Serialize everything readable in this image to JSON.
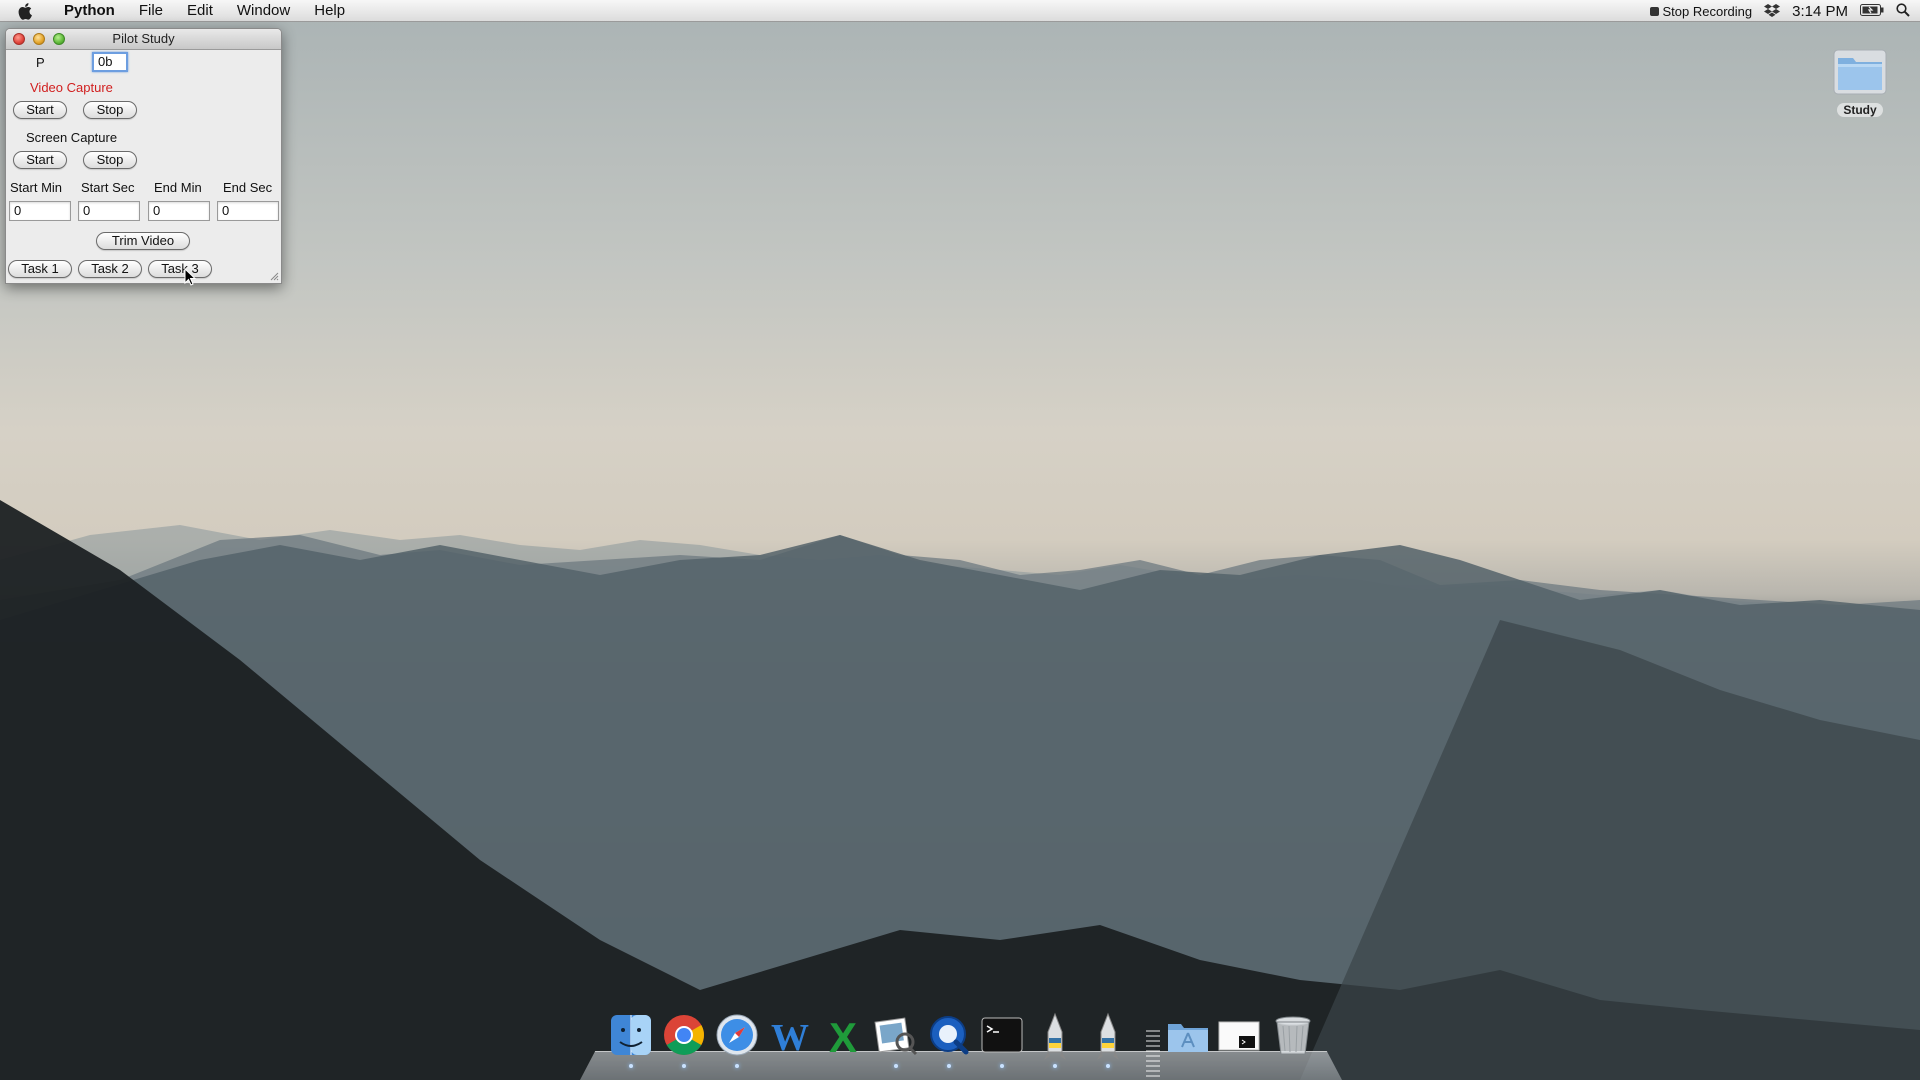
{
  "menubar": {
    "app_name": "Python",
    "menus": [
      "File",
      "Edit",
      "Window",
      "Help"
    ],
    "status": {
      "recording_label": "Stop Recording",
      "clock": "3:14 PM"
    }
  },
  "window": {
    "title": "Pilot Study",
    "participant_label": "P",
    "participant_value": "0b",
    "video_capture_label": "Video Capture",
    "screen_capture_label": "Screen Capture",
    "start_label": "Start",
    "stop_label": "Stop",
    "trim_headers": [
      "Start Min",
      "Start Sec",
      "End Min",
      "End Sec"
    ],
    "trim_values": [
      "0",
      "0",
      "0",
      "0"
    ],
    "trim_button": "Trim Video",
    "tasks": [
      "Task 1",
      "Task 2",
      "Task 3"
    ]
  },
  "desktop": {
    "folder_label": "Study"
  },
  "dock": {
    "apps": [
      "finder-icon",
      "chrome-icon",
      "safari-icon",
      "word-icon",
      "excel-icon",
      "preview-icon",
      "quicktime-icon",
      "terminal-icon",
      "python-launcher-icon",
      "python-launcher-2-icon",
      "applications-folder-icon",
      "document-icon",
      "trash-icon"
    ]
  },
  "colors": {
    "accent_red": "#d11f1f",
    "focus_blue": "#6d9ee0"
  }
}
